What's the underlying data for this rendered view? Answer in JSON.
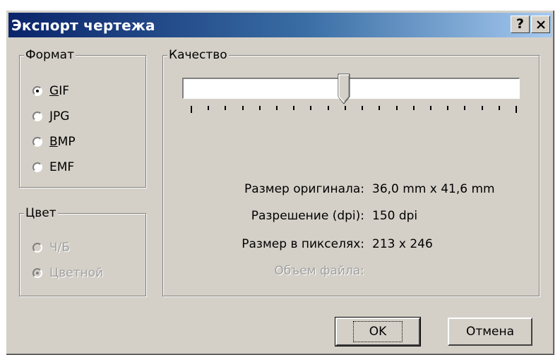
{
  "window": {
    "title": "Экспорт чертежа",
    "help_label": "?",
    "close_label": "✕"
  },
  "format": {
    "legend": "Формат",
    "options": [
      {
        "accel": "G",
        "rest": "IF",
        "checked": true
      },
      {
        "accel": "",
        "rest": "JPG",
        "checked": false
      },
      {
        "accel": "B",
        "rest": "MP",
        "checked": false
      },
      {
        "accel": "",
        "rest": "EMF",
        "checked": false
      }
    ]
  },
  "color": {
    "legend": "Цвет",
    "options": [
      {
        "label": "Ч/Б",
        "checked": false,
        "disabled": true
      },
      {
        "label": "Цветной",
        "checked": true,
        "disabled": true
      }
    ]
  },
  "quality": {
    "legend": "Качество",
    "slider_value_fraction": 0.47,
    "tick_count": 20
  },
  "info": {
    "original_size_label": "Размер оригинала:",
    "original_size_value": "36,0 mm x 41,6 mm",
    "resolution_label": "Разрешение (dpi):",
    "resolution_value": "150 dpi",
    "pixel_size_label": "Размер в пикселях:",
    "pixel_size_value": "213 x 246",
    "file_size_label": "Объем файла:",
    "file_size_value": ""
  },
  "buttons": {
    "ok_label": "OK",
    "cancel_label": "Отмена"
  },
  "colors": {
    "dialog_bg": "#d4d0c8",
    "titlebar_start": "#0a246a",
    "titlebar_end": "#a6caf0"
  }
}
